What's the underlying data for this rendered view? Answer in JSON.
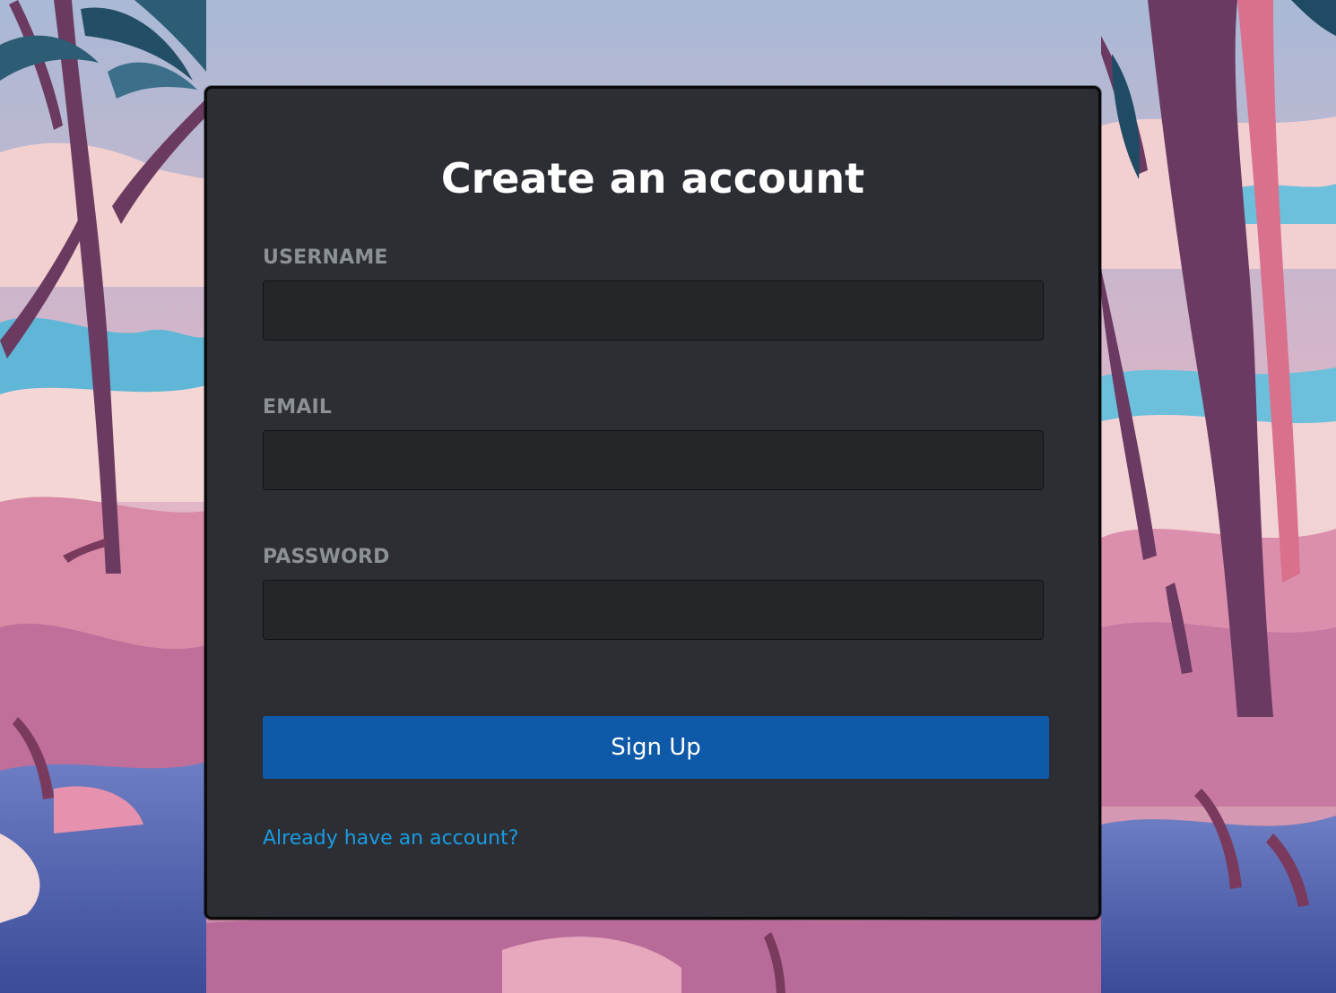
{
  "page": {
    "title": "Create an account"
  },
  "form": {
    "username": {
      "label": "USERNAME",
      "value": "",
      "placeholder": ""
    },
    "email": {
      "label": "EMAIL",
      "value": "",
      "placeholder": ""
    },
    "password": {
      "label": "PASSWORD",
      "value": "",
      "placeholder": ""
    },
    "submit_label": "Sign Up",
    "login_link": "Already have an account?"
  },
  "colors": {
    "card_background": "#2c2e33",
    "input_background": "#24272a",
    "button": "#0e5aa9",
    "link": "#1a9be0",
    "label": "#8c9196"
  }
}
